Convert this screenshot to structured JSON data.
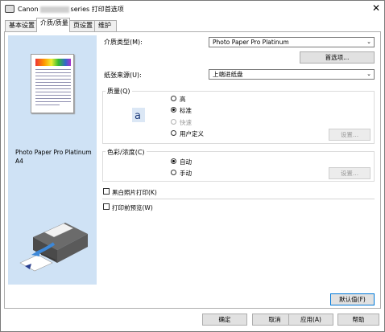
{
  "window": {
    "title_prefix": "Canon",
    "title_suffix": "series 打印首选项",
    "close_glyph": "✕"
  },
  "tabs": [
    {
      "label": "基本设置",
      "active": false
    },
    {
      "label": "介质/质量",
      "active": true
    },
    {
      "label": "页设置",
      "active": false
    },
    {
      "label": "维护",
      "active": false
    }
  ],
  "preview": {
    "media_name": "Photo Paper Pro Platinum",
    "paper_size": "A4"
  },
  "media": {
    "label": "介质类型(M):",
    "value": "Photo Paper Pro Platinum",
    "preferences_button": "首选项..."
  },
  "paper_source": {
    "label": "纸张来源(U):",
    "value": "上端进纸盘"
  },
  "quality": {
    "group_label": "质量(Q)",
    "options": [
      {
        "label": "高",
        "checked": false,
        "disabled": false
      },
      {
        "label": "标准",
        "checked": true,
        "disabled": false
      },
      {
        "label": "快速",
        "checked": false,
        "disabled": true
      },
      {
        "label": "用户定义",
        "checked": false,
        "disabled": false
      }
    ],
    "settings_button": "设置..."
  },
  "intensity": {
    "group_label": "色彩/浓度(C)",
    "options": [
      {
        "label": "自动",
        "checked": true
      },
      {
        "label": "手动",
        "checked": false
      }
    ],
    "settings_button": "设置..."
  },
  "grayscale": {
    "label": "黑白照片打印(K)",
    "checked": false
  },
  "print_preview": {
    "label": "打印前预览(W)",
    "checked": false
  },
  "defaults_button": "默认值(F)",
  "footer": {
    "ok": "确定",
    "cancel": "取消",
    "apply": "应用(A)",
    "help": "帮助"
  },
  "colors": {
    "preview_bg": "#cfe2f5",
    "button_bg": "#e1e1e1",
    "focus_border": "#0078d7"
  },
  "icons": [
    "close-icon",
    "printer-illustration-icon",
    "quality-letter-icon",
    "dropdown-arrow-icon"
  ]
}
